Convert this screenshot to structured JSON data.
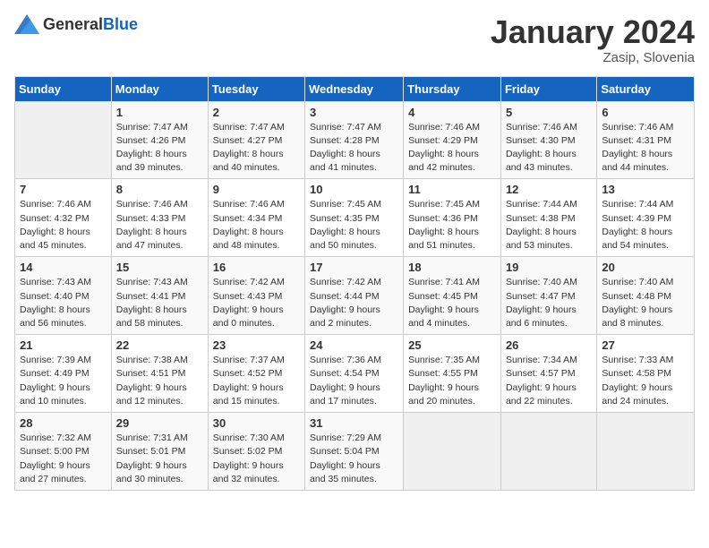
{
  "header": {
    "logo_general": "General",
    "logo_blue": "Blue",
    "month_year": "January 2024",
    "location": "Zasip, Slovenia"
  },
  "columns": [
    "Sunday",
    "Monday",
    "Tuesday",
    "Wednesday",
    "Thursday",
    "Friday",
    "Saturday"
  ],
  "weeks": [
    [
      {
        "day": "",
        "sunrise": "",
        "sunset": "",
        "daylight": ""
      },
      {
        "day": "1",
        "sunrise": "Sunrise: 7:47 AM",
        "sunset": "Sunset: 4:26 PM",
        "daylight": "Daylight: 8 hours and 39 minutes."
      },
      {
        "day": "2",
        "sunrise": "Sunrise: 7:47 AM",
        "sunset": "Sunset: 4:27 PM",
        "daylight": "Daylight: 8 hours and 40 minutes."
      },
      {
        "day": "3",
        "sunrise": "Sunrise: 7:47 AM",
        "sunset": "Sunset: 4:28 PM",
        "daylight": "Daylight: 8 hours and 41 minutes."
      },
      {
        "day": "4",
        "sunrise": "Sunrise: 7:46 AM",
        "sunset": "Sunset: 4:29 PM",
        "daylight": "Daylight: 8 hours and 42 minutes."
      },
      {
        "day": "5",
        "sunrise": "Sunrise: 7:46 AM",
        "sunset": "Sunset: 4:30 PM",
        "daylight": "Daylight: 8 hours and 43 minutes."
      },
      {
        "day": "6",
        "sunrise": "Sunrise: 7:46 AM",
        "sunset": "Sunset: 4:31 PM",
        "daylight": "Daylight: 8 hours and 44 minutes."
      }
    ],
    [
      {
        "day": "7",
        "sunrise": "Sunrise: 7:46 AM",
        "sunset": "Sunset: 4:32 PM",
        "daylight": "Daylight: 8 hours and 45 minutes."
      },
      {
        "day": "8",
        "sunrise": "Sunrise: 7:46 AM",
        "sunset": "Sunset: 4:33 PM",
        "daylight": "Daylight: 8 hours and 47 minutes."
      },
      {
        "day": "9",
        "sunrise": "Sunrise: 7:46 AM",
        "sunset": "Sunset: 4:34 PM",
        "daylight": "Daylight: 8 hours and 48 minutes."
      },
      {
        "day": "10",
        "sunrise": "Sunrise: 7:45 AM",
        "sunset": "Sunset: 4:35 PM",
        "daylight": "Daylight: 8 hours and 50 minutes."
      },
      {
        "day": "11",
        "sunrise": "Sunrise: 7:45 AM",
        "sunset": "Sunset: 4:36 PM",
        "daylight": "Daylight: 8 hours and 51 minutes."
      },
      {
        "day": "12",
        "sunrise": "Sunrise: 7:44 AM",
        "sunset": "Sunset: 4:38 PM",
        "daylight": "Daylight: 8 hours and 53 minutes."
      },
      {
        "day": "13",
        "sunrise": "Sunrise: 7:44 AM",
        "sunset": "Sunset: 4:39 PM",
        "daylight": "Daylight: 8 hours and 54 minutes."
      }
    ],
    [
      {
        "day": "14",
        "sunrise": "Sunrise: 7:43 AM",
        "sunset": "Sunset: 4:40 PM",
        "daylight": "Daylight: 8 hours and 56 minutes."
      },
      {
        "day": "15",
        "sunrise": "Sunrise: 7:43 AM",
        "sunset": "Sunset: 4:41 PM",
        "daylight": "Daylight: 8 hours and 58 minutes."
      },
      {
        "day": "16",
        "sunrise": "Sunrise: 7:42 AM",
        "sunset": "Sunset: 4:43 PM",
        "daylight": "Daylight: 9 hours and 0 minutes."
      },
      {
        "day": "17",
        "sunrise": "Sunrise: 7:42 AM",
        "sunset": "Sunset: 4:44 PM",
        "daylight": "Daylight: 9 hours and 2 minutes."
      },
      {
        "day": "18",
        "sunrise": "Sunrise: 7:41 AM",
        "sunset": "Sunset: 4:45 PM",
        "daylight": "Daylight: 9 hours and 4 minutes."
      },
      {
        "day": "19",
        "sunrise": "Sunrise: 7:40 AM",
        "sunset": "Sunset: 4:47 PM",
        "daylight": "Daylight: 9 hours and 6 minutes."
      },
      {
        "day": "20",
        "sunrise": "Sunrise: 7:40 AM",
        "sunset": "Sunset: 4:48 PM",
        "daylight": "Daylight: 9 hours and 8 minutes."
      }
    ],
    [
      {
        "day": "21",
        "sunrise": "Sunrise: 7:39 AM",
        "sunset": "Sunset: 4:49 PM",
        "daylight": "Daylight: 9 hours and 10 minutes."
      },
      {
        "day": "22",
        "sunrise": "Sunrise: 7:38 AM",
        "sunset": "Sunset: 4:51 PM",
        "daylight": "Daylight: 9 hours and 12 minutes."
      },
      {
        "day": "23",
        "sunrise": "Sunrise: 7:37 AM",
        "sunset": "Sunset: 4:52 PM",
        "daylight": "Daylight: 9 hours and 15 minutes."
      },
      {
        "day": "24",
        "sunrise": "Sunrise: 7:36 AM",
        "sunset": "Sunset: 4:54 PM",
        "daylight": "Daylight: 9 hours and 17 minutes."
      },
      {
        "day": "25",
        "sunrise": "Sunrise: 7:35 AM",
        "sunset": "Sunset: 4:55 PM",
        "daylight": "Daylight: 9 hours and 20 minutes."
      },
      {
        "day": "26",
        "sunrise": "Sunrise: 7:34 AM",
        "sunset": "Sunset: 4:57 PM",
        "daylight": "Daylight: 9 hours and 22 minutes."
      },
      {
        "day": "27",
        "sunrise": "Sunrise: 7:33 AM",
        "sunset": "Sunset: 4:58 PM",
        "daylight": "Daylight: 9 hours and 24 minutes."
      }
    ],
    [
      {
        "day": "28",
        "sunrise": "Sunrise: 7:32 AM",
        "sunset": "Sunset: 5:00 PM",
        "daylight": "Daylight: 9 hours and 27 minutes."
      },
      {
        "day": "29",
        "sunrise": "Sunrise: 7:31 AM",
        "sunset": "Sunset: 5:01 PM",
        "daylight": "Daylight: 9 hours and 30 minutes."
      },
      {
        "day": "30",
        "sunrise": "Sunrise: 7:30 AM",
        "sunset": "Sunset: 5:02 PM",
        "daylight": "Daylight: 9 hours and 32 minutes."
      },
      {
        "day": "31",
        "sunrise": "Sunrise: 7:29 AM",
        "sunset": "Sunset: 5:04 PM",
        "daylight": "Daylight: 9 hours and 35 minutes."
      },
      {
        "day": "",
        "sunrise": "",
        "sunset": "",
        "daylight": ""
      },
      {
        "day": "",
        "sunrise": "",
        "sunset": "",
        "daylight": ""
      },
      {
        "day": "",
        "sunrise": "",
        "sunset": "",
        "daylight": ""
      }
    ]
  ]
}
